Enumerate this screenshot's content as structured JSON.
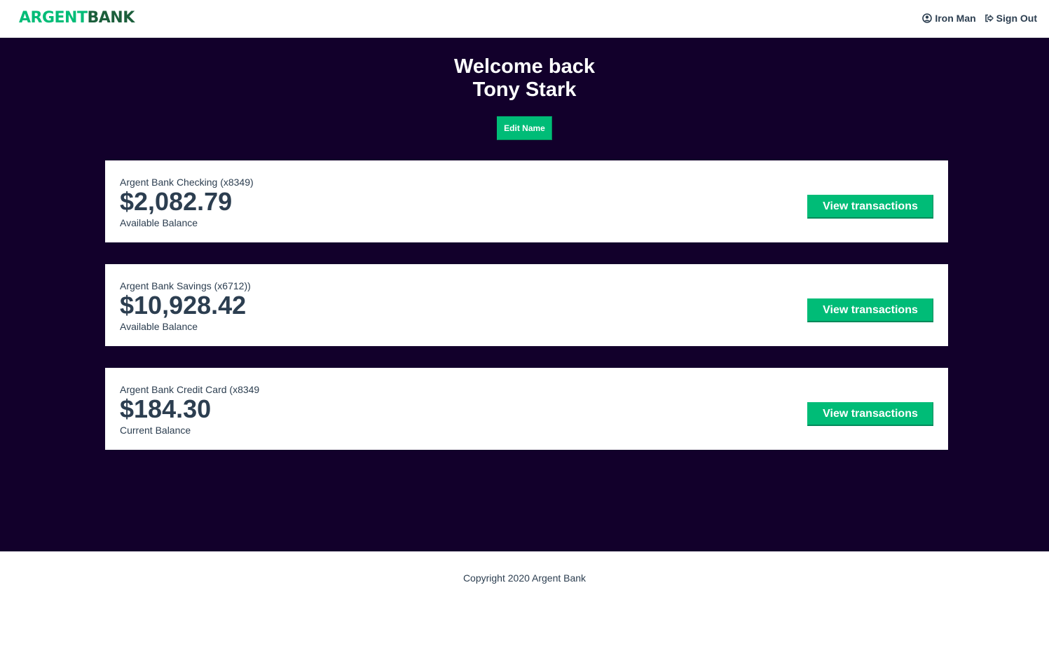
{
  "nav": {
    "logo_part1": "ARGENT",
    "logo_part2": "BANK",
    "user_name": "Iron Man",
    "user_icon": "user-circle-icon",
    "sign_out_label": "Sign Out",
    "sign_out_icon": "sign-out-icon"
  },
  "header": {
    "line1": "Welcome back",
    "line2": "Tony Stark",
    "edit_label": "Edit Name"
  },
  "accounts": [
    {
      "title": "Argent Bank Checking (x8349)",
      "amount": "$2,082.79",
      "description": "Available Balance",
      "button_label": "View transactions"
    },
    {
      "title": "Argent Bank Savings (x6712))",
      "amount": "$10,928.42",
      "description": "Available Balance",
      "button_label": "View transactions"
    },
    {
      "title": "Argent Bank Credit Card (x8349",
      "amount": "$184.30",
      "description": "Current Balance",
      "button_label": "View transactions"
    }
  ],
  "footer": {
    "copyright": "Copyright 2020 Argent Bank"
  },
  "colors": {
    "accent": "#00bc77",
    "main_background": "#12002b",
    "text": "#2c3e50"
  }
}
